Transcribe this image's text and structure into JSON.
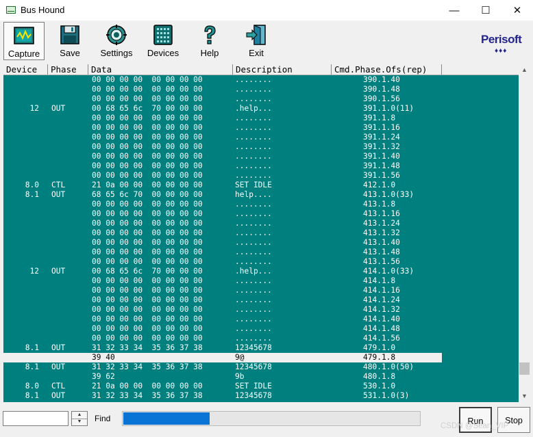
{
  "window": {
    "title": "Bus Hound",
    "minimize": "—",
    "maximize": "☐",
    "close": "✕"
  },
  "toolbar": {
    "items": [
      {
        "label": "Capture",
        "icon": "capture-icon"
      },
      {
        "label": "Save",
        "icon": "save-icon"
      },
      {
        "label": "Settings",
        "icon": "settings-icon"
      },
      {
        "label": "Devices",
        "icon": "devices-icon"
      },
      {
        "label": "Help",
        "icon": "help-icon"
      },
      {
        "label": "Exit",
        "icon": "exit-icon"
      }
    ],
    "logo": "Perisoft",
    "logo_dots": "♦♦♦"
  },
  "grid": {
    "headers": [
      "Device",
      "Phase",
      "Data",
      "Description",
      "Cmd.Phase.Ofs(rep)"
    ],
    "rows": [
      {
        "device": "",
        "phase": "",
        "data": "00 00 00 00  00 00 00 00",
        "desc": "........",
        "cmd": "390.1.40"
      },
      {
        "device": "",
        "phase": "",
        "data": "00 00 00 00  00 00 00 00",
        "desc": "........",
        "cmd": "390.1.48"
      },
      {
        "device": "",
        "phase": "",
        "data": "00 00 00 00  00 00 00 00",
        "desc": "........",
        "cmd": "390.1.56"
      },
      {
        "device": "12",
        "phase": "OUT",
        "data": "00 68 65 6c  70 00 00 00",
        "desc": ".help...",
        "cmd": "391.1.0(11)"
      },
      {
        "device": "",
        "phase": "",
        "data": "00 00 00 00  00 00 00 00",
        "desc": "........",
        "cmd": "391.1.8"
      },
      {
        "device": "",
        "phase": "",
        "data": "00 00 00 00  00 00 00 00",
        "desc": "........",
        "cmd": "391.1.16"
      },
      {
        "device": "",
        "phase": "",
        "data": "00 00 00 00  00 00 00 00",
        "desc": "........",
        "cmd": "391.1.24"
      },
      {
        "device": "",
        "phase": "",
        "data": "00 00 00 00  00 00 00 00",
        "desc": "........",
        "cmd": "391.1.32"
      },
      {
        "device": "",
        "phase": "",
        "data": "00 00 00 00  00 00 00 00",
        "desc": "........",
        "cmd": "391.1.40"
      },
      {
        "device": "",
        "phase": "",
        "data": "00 00 00 00  00 00 00 00",
        "desc": "........",
        "cmd": "391.1.48"
      },
      {
        "device": "",
        "phase": "",
        "data": "00 00 00 00  00 00 00 00",
        "desc": "........",
        "cmd": "391.1.56"
      },
      {
        "device": "8.0",
        "phase": "CTL",
        "data": "21 0a 00 00  00 00 00 00",
        "desc": "SET IDLE",
        "cmd": "412.1.0"
      },
      {
        "device": "8.1",
        "phase": "OUT",
        "data": "68 65 6c 70  00 00 00 00",
        "desc": "help....",
        "cmd": "413.1.0(33)"
      },
      {
        "device": "",
        "phase": "",
        "data": "00 00 00 00  00 00 00 00",
        "desc": "........",
        "cmd": "413.1.8"
      },
      {
        "device": "",
        "phase": "",
        "data": "00 00 00 00  00 00 00 00",
        "desc": "........",
        "cmd": "413.1.16"
      },
      {
        "device": "",
        "phase": "",
        "data": "00 00 00 00  00 00 00 00",
        "desc": "........",
        "cmd": "413.1.24"
      },
      {
        "device": "",
        "phase": "",
        "data": "00 00 00 00  00 00 00 00",
        "desc": "........",
        "cmd": "413.1.32"
      },
      {
        "device": "",
        "phase": "",
        "data": "00 00 00 00  00 00 00 00",
        "desc": "........",
        "cmd": "413.1.40"
      },
      {
        "device": "",
        "phase": "",
        "data": "00 00 00 00  00 00 00 00",
        "desc": "........",
        "cmd": "413.1.48"
      },
      {
        "device": "",
        "phase": "",
        "data": "00 00 00 00  00 00 00 00",
        "desc": "........",
        "cmd": "413.1.56"
      },
      {
        "device": "12",
        "phase": "OUT",
        "data": "00 68 65 6c  70 00 00 00",
        "desc": ".help...",
        "cmd": "414.1.0(33)"
      },
      {
        "device": "",
        "phase": "",
        "data": "00 00 00 00  00 00 00 00",
        "desc": "........",
        "cmd": "414.1.8"
      },
      {
        "device": "",
        "phase": "",
        "data": "00 00 00 00  00 00 00 00",
        "desc": "........",
        "cmd": "414.1.16"
      },
      {
        "device": "",
        "phase": "",
        "data": "00 00 00 00  00 00 00 00",
        "desc": "........",
        "cmd": "414.1.24"
      },
      {
        "device": "",
        "phase": "",
        "data": "00 00 00 00  00 00 00 00",
        "desc": "........",
        "cmd": "414.1.32"
      },
      {
        "device": "",
        "phase": "",
        "data": "00 00 00 00  00 00 00 00",
        "desc": "........",
        "cmd": "414.1.40"
      },
      {
        "device": "",
        "phase": "",
        "data": "00 00 00 00  00 00 00 00",
        "desc": "........",
        "cmd": "414.1.48"
      },
      {
        "device": "",
        "phase": "",
        "data": "00 00 00 00  00 00 00 00",
        "desc": "........",
        "cmd": "414.1.56"
      },
      {
        "device": "8.1",
        "phase": "OUT",
        "data": "31 32 33 34  35 36 37 38",
        "desc": "12345678",
        "cmd": "479.1.0"
      },
      {
        "device": "",
        "phase": "",
        "data": "39 40",
        "desc": "9@",
        "cmd": "479.1.8",
        "selected": true
      },
      {
        "device": "8.1",
        "phase": "OUT",
        "data": "31 32 33 34  35 36 37 38",
        "desc": "12345678",
        "cmd": "480.1.0(50)"
      },
      {
        "device": "",
        "phase": "",
        "data": "39 62",
        "desc": "9b",
        "cmd": "480.1.8"
      },
      {
        "device": "8.0",
        "phase": "CTL",
        "data": "21 0a 00 00  00 00 00 00",
        "desc": "SET IDLE",
        "cmd": "530.1.0"
      },
      {
        "device": "8.1",
        "phase": "OUT",
        "data": "31 32 33 34  35 36 37 38",
        "desc": "12345678",
        "cmd": "531.1.0(3)"
      }
    ]
  },
  "bottom": {
    "find_value": "",
    "find_label": "Find",
    "progress": 0.29,
    "run_label": "Run",
    "stop_label": "Stop",
    "watermark": "CSDN @Sean_VIP"
  },
  "colors": {
    "grid_bg": "#007f7f",
    "grid_text": "#ffffff",
    "selection_bg": "#f0f0f0",
    "progress_fill": "#0a74d6",
    "logo": "#23238f"
  }
}
